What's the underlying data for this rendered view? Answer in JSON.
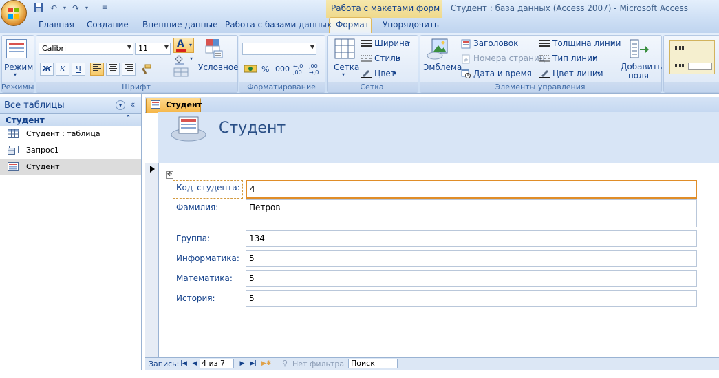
{
  "window": {
    "contextual_group": "Работа с макетами форм",
    "title": "Студент : база данных (Access 2007)  -  Microsoft Access"
  },
  "ribbon_tabs": [
    "Главная",
    "Создание",
    "Внешние данные",
    "Работа с базами данных",
    "Формат",
    "Упорядочить"
  ],
  "active_tab": "Формат",
  "ribbon": {
    "rezhimy": {
      "button": "Режим",
      "label": "Режимы"
    },
    "font": {
      "family": "Calibri",
      "size": "11",
      "bold": "Ж",
      "italic": "К",
      "underline": "Ч",
      "conditional": "Условное",
      "label": "Шрифт"
    },
    "formatting": {
      "label": "Форматирование",
      "percent": "%",
      "thousands": "000"
    },
    "grid": {
      "button": "Сетка",
      "width": "Ширина",
      "style": "Стиль",
      "color": "Цвет",
      "label": "Сетка"
    },
    "controls": {
      "emblem": "Эмблема",
      "heading": "Заголовок",
      "page_numbers": "Номера страниц",
      "datetime": "Дата и время",
      "line_thickness": "Толщина линии",
      "line_type": "Тип линии",
      "line_color": "Цвет линии",
      "add_field": "Добавить поля",
      "label": "Элементы управления"
    }
  },
  "nav_pane": {
    "title": "Все таблицы",
    "group": "Студент",
    "items": [
      {
        "label": "Студент : таблица",
        "icon": "table-icon"
      },
      {
        "label": "Запрос1",
        "icon": "query-icon"
      },
      {
        "label": "Студент",
        "icon": "form-icon",
        "selected": true
      }
    ]
  },
  "document": {
    "tab": "Студент",
    "form_title": "Студент",
    "fields": [
      {
        "label": "Код_студента:",
        "value": "4"
      },
      {
        "label": "Фамилия:",
        "value": "Петров"
      },
      {
        "label": "Группа:",
        "value": "134"
      },
      {
        "label": "Информатика:",
        "value": "5"
      },
      {
        "label": "Математика:",
        "value": "5"
      },
      {
        "label": "История:",
        "value": "5"
      }
    ]
  },
  "record_nav": {
    "label": "Запись:",
    "position": "4 из 7",
    "filter": "Нет фильтра",
    "search_placeholder": "Поиск"
  }
}
